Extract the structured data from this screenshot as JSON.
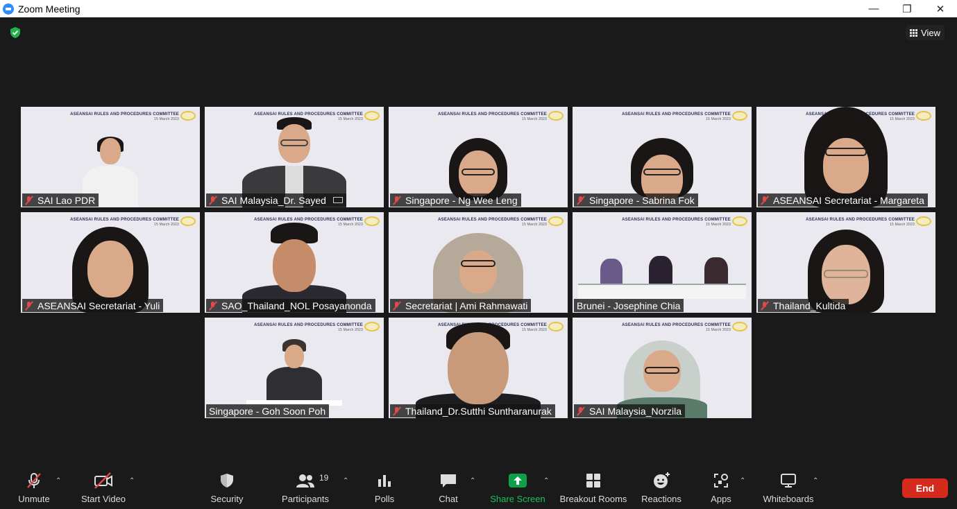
{
  "window": {
    "title": "Zoom Meeting",
    "minimize": "—",
    "restore": "❐",
    "close": "✕"
  },
  "topbar": {
    "view_label": "View"
  },
  "banner": {
    "title": "ASEANSAI RULES AND PROCEDURES COMMITTEE",
    "date": "15 March 2023"
  },
  "participants": [
    {
      "name": "SAI Lao PDR",
      "muted": true
    },
    {
      "name": "SAI Malaysia_Dr. Sayed",
      "muted": true
    },
    {
      "name": "Singapore - Ng Wee Leng",
      "muted": true
    },
    {
      "name": "Singapore - Sabrina Fok",
      "muted": true
    },
    {
      "name": "ASEANSAI Secretariat - Margareta",
      "muted": true
    },
    {
      "name": "ASEANSAI Secretariat - Yuli",
      "muted": true
    },
    {
      "name": "SAO_Thailand_NOL Posayanonda",
      "muted": true
    },
    {
      "name": "Secretariat | Ami Rahmawati",
      "muted": true
    },
    {
      "name": "Brunei - Josephine Chia",
      "muted": false
    },
    {
      "name": "Thailand_Kultida",
      "muted": true
    },
    {
      "name": "Singapore - Goh Soon Poh",
      "muted": false
    },
    {
      "name": "Thailand_Dr.Sutthi Suntharanurak",
      "muted": true
    },
    {
      "name": "SAI Malaysia_Norzila",
      "muted": true
    }
  ],
  "toolbar": {
    "unmute": "Unmute",
    "start_video": "Start Video",
    "security": "Security",
    "participants": "Participants",
    "participants_count": "19",
    "polls": "Polls",
    "chat": "Chat",
    "share_screen": "Share Screen",
    "breakout_rooms": "Breakout Rooms",
    "reactions": "Reactions",
    "apps": "Apps",
    "whiteboards": "Whiteboards",
    "end": "End",
    "caret": "⌃"
  },
  "colors": {
    "background": "#1a1a1a",
    "share_green": "#0e9f4b",
    "end_red": "#d52b1e",
    "mute_red": "#e24a4a",
    "shield_green": "#23b24a"
  }
}
